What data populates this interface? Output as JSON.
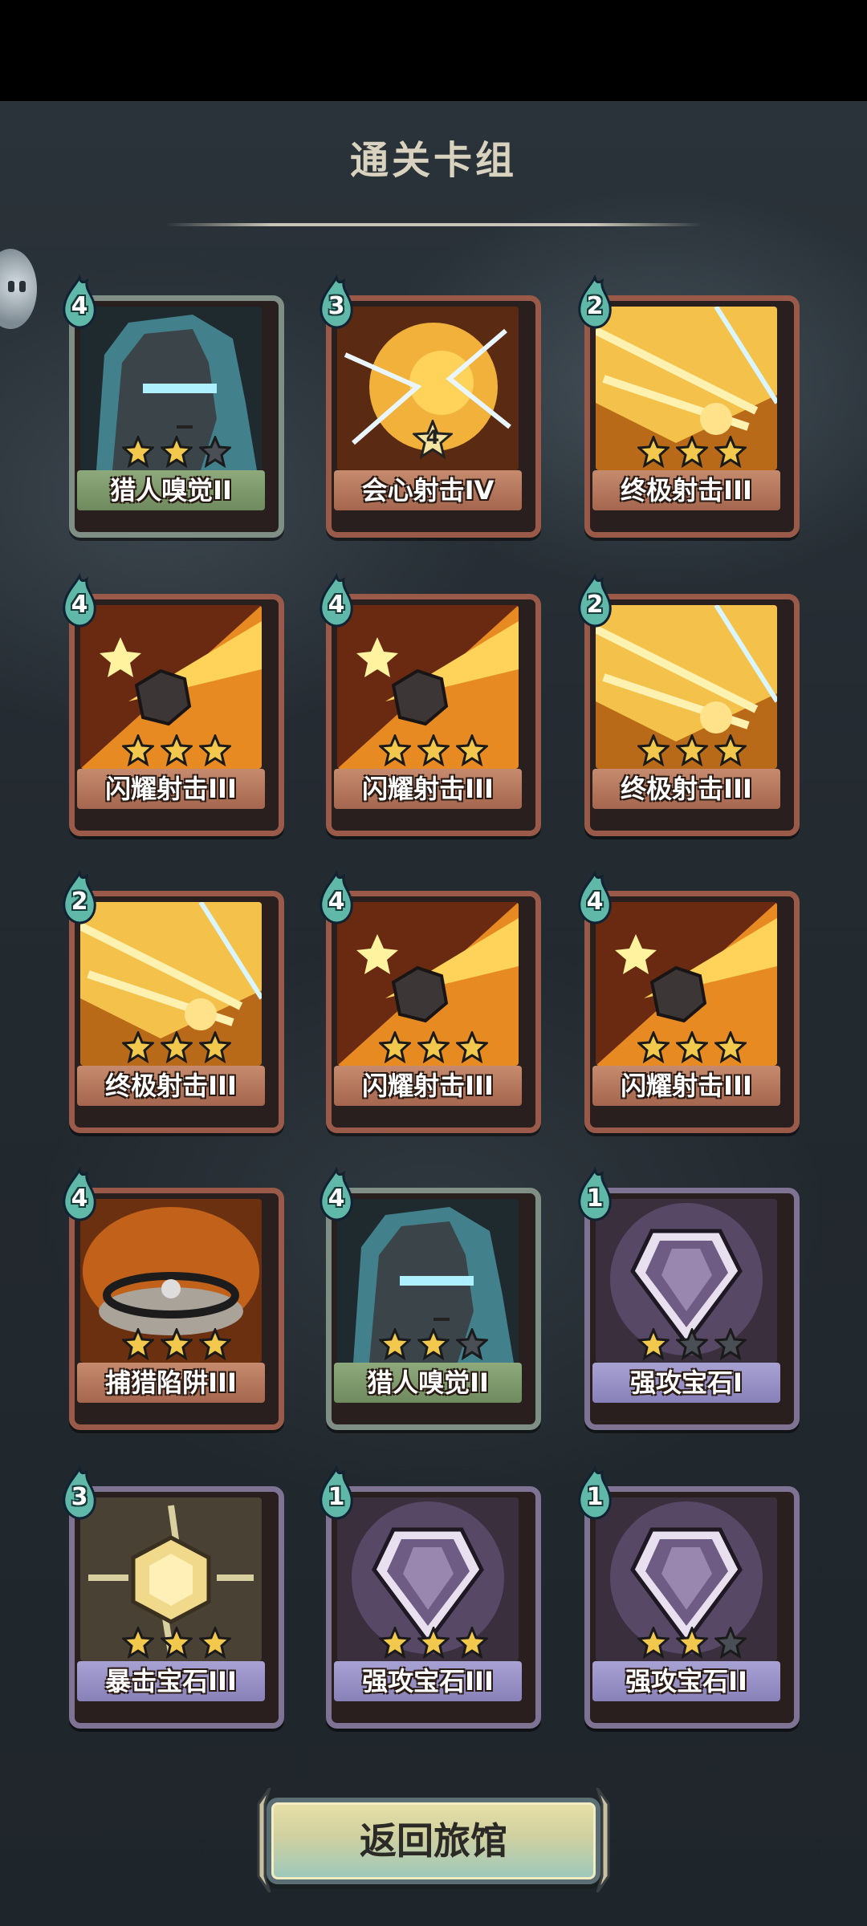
{
  "header": {
    "title": "通关卡组"
  },
  "cards": [
    {
      "name": "猎人嗅觉II",
      "cost": "4",
      "stars": 2,
      "max_stars": 3,
      "theme": "green",
      "art": "hunter"
    },
    {
      "name": "会心射击IV",
      "cost": "3",
      "stars": 0,
      "max_stars": 0,
      "level": "4",
      "theme": "red",
      "art": "crit"
    },
    {
      "name": "终极射击III",
      "cost": "2",
      "stars": 3,
      "max_stars": 3,
      "theme": "red",
      "art": "ultimate"
    },
    {
      "name": "闪耀射击III",
      "cost": "4",
      "stars": 3,
      "max_stars": 3,
      "theme": "red",
      "art": "shine"
    },
    {
      "name": "闪耀射击III",
      "cost": "4",
      "stars": 3,
      "max_stars": 3,
      "theme": "red",
      "art": "shine"
    },
    {
      "name": "终极射击III",
      "cost": "2",
      "stars": 3,
      "max_stars": 3,
      "theme": "red",
      "art": "ultimate"
    },
    {
      "name": "终极射击III",
      "cost": "2",
      "stars": 3,
      "max_stars": 3,
      "theme": "red",
      "art": "ultimate"
    },
    {
      "name": "闪耀射击III",
      "cost": "4",
      "stars": 3,
      "max_stars": 3,
      "theme": "red",
      "art": "shine"
    },
    {
      "name": "闪耀射击III",
      "cost": "4",
      "stars": 3,
      "max_stars": 3,
      "theme": "red",
      "art": "shine"
    },
    {
      "name": "捕猎陷阱III",
      "cost": "4",
      "stars": 3,
      "max_stars": 3,
      "theme": "red",
      "art": "trap"
    },
    {
      "name": "猎人嗅觉II",
      "cost": "4",
      "stars": 2,
      "max_stars": 3,
      "theme": "green",
      "art": "hunter"
    },
    {
      "name": "强攻宝石I",
      "cost": "1",
      "stars": 1,
      "max_stars": 3,
      "theme": "purple",
      "art": "gem"
    },
    {
      "name": "暴击宝石III",
      "cost": "3",
      "stars": 3,
      "max_stars": 3,
      "theme": "purple",
      "art": "critgem"
    },
    {
      "name": "强攻宝石III",
      "cost": "1",
      "stars": 3,
      "max_stars": 3,
      "theme": "purple",
      "art": "gem"
    },
    {
      "name": "强攻宝石II",
      "cost": "1",
      "stars": 2,
      "max_stars": 3,
      "theme": "purple",
      "art": "gem"
    }
  ],
  "footer": {
    "return_label": "返回旅馆"
  },
  "colors": {
    "star_on": "#f2c94c",
    "star_off": "#4a4f55",
    "cost_drop": "#5fb8a8"
  },
  "icons": {
    "card_cost": "water-drop-icon",
    "star": "star-icon"
  }
}
